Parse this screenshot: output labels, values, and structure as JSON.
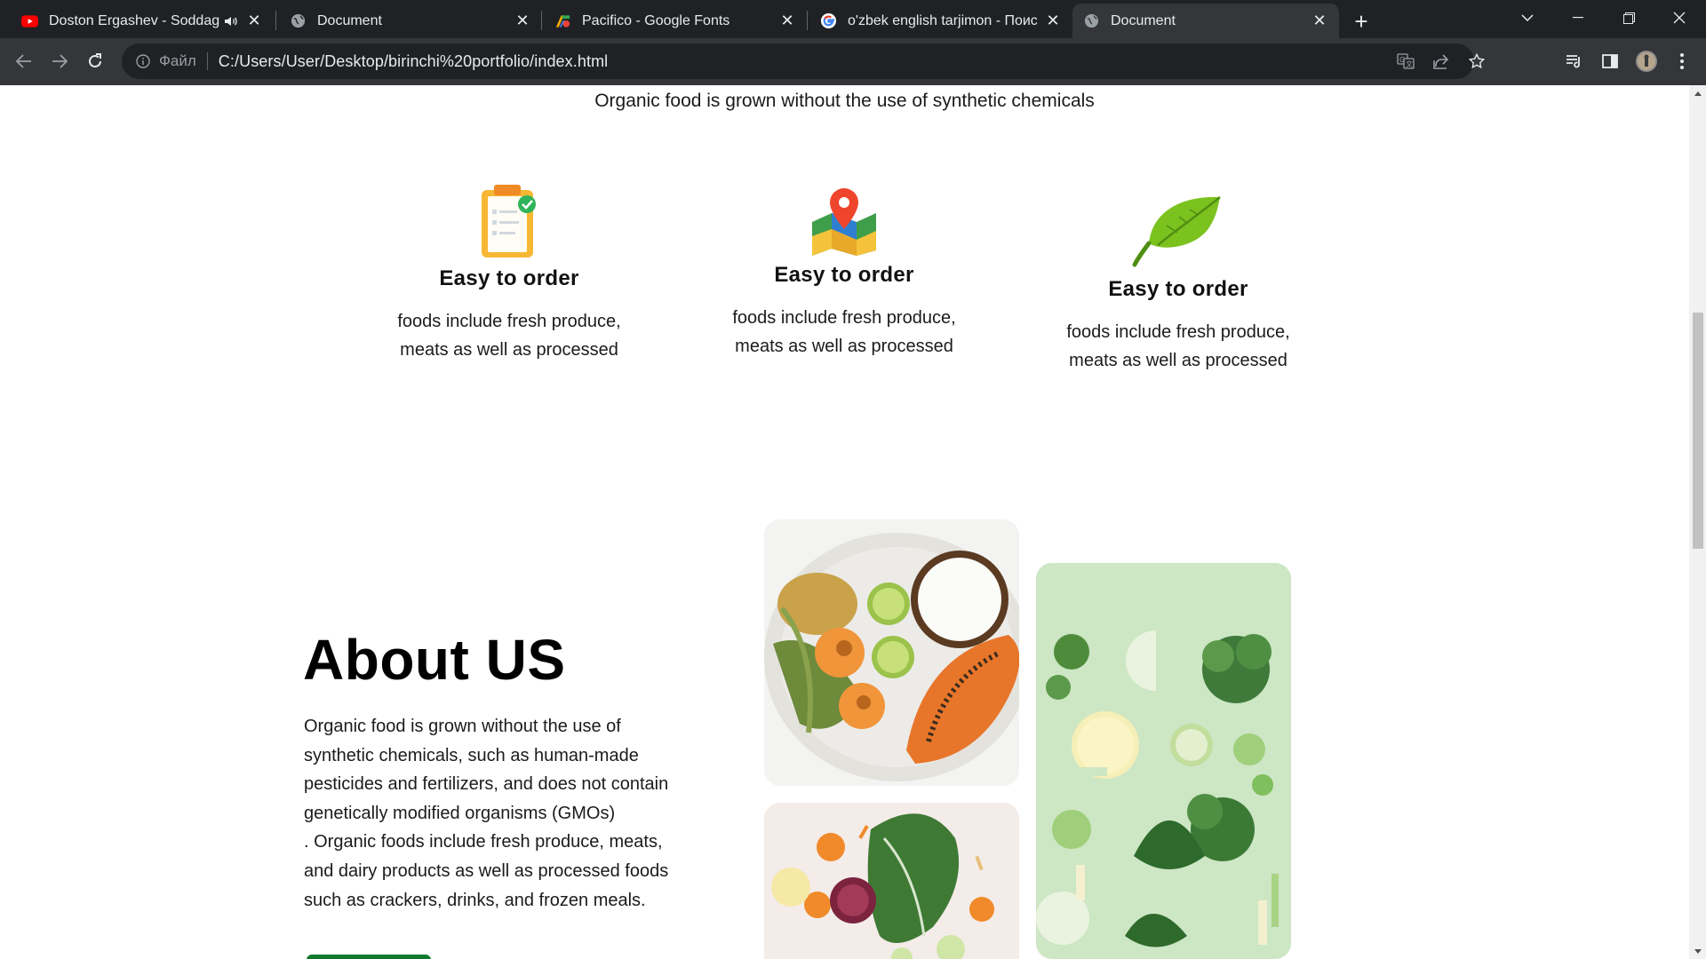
{
  "browser": {
    "tabs": [
      {
        "title": "Doston Ergashev - Soddagin",
        "favicon": "youtube-icon",
        "muted_indicator": "audio-icon"
      },
      {
        "title": "Document",
        "favicon": "globe-icon"
      },
      {
        "title": "Pacifico - Google Fonts",
        "favicon": "google-fonts-icon"
      },
      {
        "title": "o'zbek english tarjimon - Поиск в",
        "favicon": "google-icon"
      },
      {
        "title": "Document",
        "favicon": "globe-icon",
        "active": true
      }
    ],
    "address_bar": {
      "scheme_label": "Файл",
      "url": "C:/Users/User/Desktop/birinchi%20portfolio/index.html"
    }
  },
  "page": {
    "intro_text": "Organic food is grown without the use of synthetic chemicals",
    "features": [
      {
        "icon": "clipboard-check-icon",
        "title": "Easy to order",
        "line1": "foods include fresh produce,",
        "line2": "meats as well as processed"
      },
      {
        "icon": "map-pin-icon",
        "title": "Easy to order",
        "line1": "foods include fresh produce,",
        "line2": "meats as well as processed"
      },
      {
        "icon": "leaf-icon",
        "title": "Easy to order",
        "line1": "foods include fresh produce,",
        "line2": "meats as well as processed"
      }
    ],
    "about": {
      "title": "About US",
      "paragraph_lines": [
        "Organic food is grown without the use of",
        "synthetic chemicals, such as human-made",
        "pesticides and fertilizers, and does not contain",
        "genetically modified organisms (GMOs)",
        ". Organic foods include fresh produce, meats,",
        "and dairy products as well as processed foods",
        "such as crackers, drinks, and frozen meals."
      ]
    },
    "photos": [
      "fruit-plate-photo",
      "green-vegetables-photo",
      "kale-vegetables-photo"
    ]
  },
  "colors": {
    "chrome_dark": "#202124",
    "chrome_toolbar": "#35363a",
    "accent_green": "#0f7a2d"
  }
}
